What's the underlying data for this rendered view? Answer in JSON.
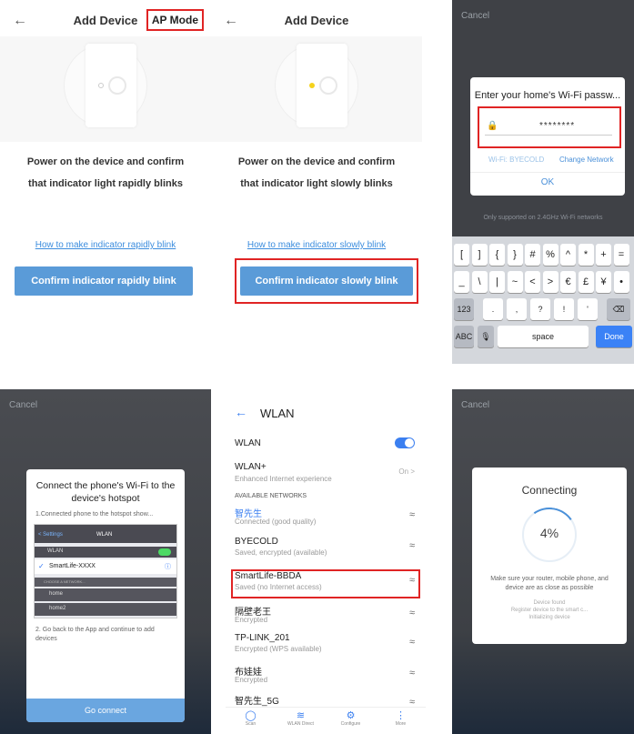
{
  "screen1": {
    "back_icon": "arrow-left-icon",
    "title": "Add Device",
    "ap_mode": "AP Mode",
    "instruction_line1": "Power on the device and confirm",
    "instruction_line2": "that indicator light rapidly blinks",
    "help_link": "How to make indicator rapidly blink",
    "confirm_button": "Confirm indicator rapidly blink"
  },
  "screen2": {
    "back_icon": "arrow-left-icon",
    "title": "Add Device",
    "instruction_line1": "Power on the device and confirm",
    "instruction_line2": "that indicator light slowly blinks",
    "help_link": "How to make indicator slowly blink",
    "confirm_button": "Confirm indicator slowly blink",
    "led_color": "#f5d21c"
  },
  "screen3": {
    "cancel": "Cancel",
    "dialog_title": "Enter your home's Wi-Fi passw...",
    "password_mask": "********",
    "wifi_label": "Wi-Fi: BYECOLD",
    "change_network": "Change Network",
    "ok": "OK",
    "note": "Only supported on 2.4GHz Wi-Fi networks",
    "keys_row1": [
      "[",
      "]",
      "{",
      "}",
      "#",
      "%",
      "^",
      "*",
      "+",
      "="
    ],
    "keys_row2": [
      "_",
      "\\",
      "|",
      "~",
      "<",
      ">",
      "€",
      "£",
      "¥",
      "•"
    ],
    "keys_row3": [
      "123",
      ".",
      ",",
      "?",
      "!",
      "'",
      "⌫"
    ],
    "keys_row4": [
      "ABC",
      "🎙",
      "space",
      "Done"
    ]
  },
  "screen4": {
    "cancel": "Cancel",
    "title_line1": "Connect the phone's Wi-Fi to the",
    "title_line2": "device's hotspot",
    "step1": "1.Connected phone to the hotspot show...",
    "mini_status": "BELL  5:00 PM",
    "mini_back": "< Settings",
    "mini_title": "WLAN",
    "mini_wlan": "WLAN",
    "mini_selected": "SmartLife-XXXX",
    "mini_choose": "CHOOSE A NETWORK...",
    "mini_home": "home",
    "mini_home2": "home2",
    "step2": "2. Go back to the App and continue to add devices",
    "go_connect": "Go connect"
  },
  "screen5": {
    "back_icon": "arrow-left-icon",
    "title": "WLAN",
    "wlan": "WLAN",
    "wlan_plus": "WLAN+",
    "wlan_plus_sub": "Enhanced Internet experience",
    "wlan_plus_value": "On >",
    "section": "AVAILABLE NETWORKS",
    "networks": [
      {
        "name": "智先生",
        "sub": "Connected (good quality)"
      },
      {
        "name": "BYECOLD",
        "sub": "Saved, encrypted (available)"
      },
      {
        "name": "SmartLife-BBDA",
        "sub": "Saved (no Internet access)"
      },
      {
        "name": "隔壁老王",
        "sub": "Encrypted"
      },
      {
        "name": "TP-LINK_201",
        "sub": "Encrypted (WPS available)"
      },
      {
        "name": "布娃娃",
        "sub": "Encrypted"
      },
      {
        "name": "智先生_5G",
        "sub": ""
      }
    ],
    "bottom": [
      "Scan",
      "WLAN Direct",
      "Configure",
      "More"
    ]
  },
  "screen6": {
    "cancel": "Cancel",
    "title": "Connecting",
    "percent": "4%",
    "hint": "Make sure your router, mobile phone, and device are as close as possible",
    "status1": "Device found",
    "status2": "Register device to the smart c...",
    "status3": "Initializing device"
  }
}
